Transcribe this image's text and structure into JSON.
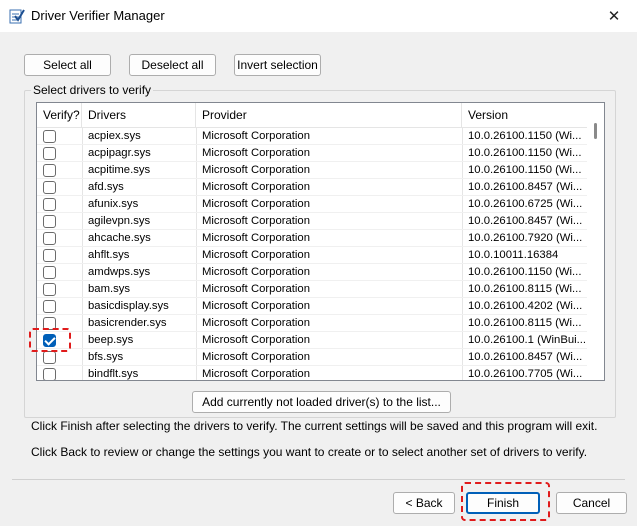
{
  "window": {
    "title": "Driver Verifier Manager"
  },
  "toolbar": {
    "select_all": "Select all",
    "deselect_all": "Deselect all",
    "invert_selection": "Invert selection"
  },
  "group_label": "Select drivers to verify",
  "columns": {
    "verify": "Verify?",
    "drivers": "Drivers",
    "provider": "Provider",
    "version": "Version"
  },
  "rows": [
    {
      "checked": false,
      "driver": "acpiex.sys",
      "provider": "Microsoft Corporation",
      "version": "10.0.26100.1150 (Wi..."
    },
    {
      "checked": false,
      "driver": "acpipagr.sys",
      "provider": "Microsoft Corporation",
      "version": "10.0.26100.1150 (Wi..."
    },
    {
      "checked": false,
      "driver": "acpitime.sys",
      "provider": "Microsoft Corporation",
      "version": "10.0.26100.1150 (Wi..."
    },
    {
      "checked": false,
      "driver": "afd.sys",
      "provider": "Microsoft Corporation",
      "version": "10.0.26100.8457 (Wi..."
    },
    {
      "checked": false,
      "driver": "afunix.sys",
      "provider": "Microsoft Corporation",
      "version": "10.0.26100.6725 (Wi..."
    },
    {
      "checked": false,
      "driver": "agilevpn.sys",
      "provider": "Microsoft Corporation",
      "version": "10.0.26100.8457 (Wi..."
    },
    {
      "checked": false,
      "driver": "ahcache.sys",
      "provider": "Microsoft Corporation",
      "version": "10.0.26100.7920 (Wi..."
    },
    {
      "checked": false,
      "driver": "ahflt.sys",
      "provider": "Microsoft Corporation",
      "version": "10.0.10011.16384"
    },
    {
      "checked": false,
      "driver": "amdwps.sys",
      "provider": "Microsoft Corporation",
      "version": "10.0.26100.1150 (Wi..."
    },
    {
      "checked": false,
      "driver": "bam.sys",
      "provider": "Microsoft Corporation",
      "version": "10.0.26100.8115 (Wi..."
    },
    {
      "checked": false,
      "driver": "basicdisplay.sys",
      "provider": "Microsoft Corporation",
      "version": "10.0.26100.4202 (Wi..."
    },
    {
      "checked": false,
      "driver": "basicrender.sys",
      "provider": "Microsoft Corporation",
      "version": "10.0.26100.8115 (Wi..."
    },
    {
      "checked": true,
      "driver": "beep.sys",
      "provider": "Microsoft Corporation",
      "version": "10.0.26100.1 (WinBui..."
    },
    {
      "checked": false,
      "driver": "bfs.sys",
      "provider": "Microsoft Corporation",
      "version": "10.0.26100.8457 (Wi..."
    },
    {
      "checked": false,
      "driver": "bindflt.sys",
      "provider": "Microsoft Corporation",
      "version": "10.0.26100.7705 (Wi..."
    }
  ],
  "add_button": "Add currently not loaded driver(s) to the list...",
  "info_text_1": "Click Finish after selecting the drivers to verify. The current settings will be saved and this program will exit.",
  "info_text_2": "Click Back to review or change the settings you want to create or to select another set of drivers to verify.",
  "footer": {
    "back": "< Back",
    "finish": "Finish",
    "cancel": "Cancel"
  },
  "icons": {
    "app": "checklist-icon",
    "close": "close-icon"
  },
  "colors": {
    "accent": "#005fb8",
    "highlight": "#e01b1b"
  }
}
